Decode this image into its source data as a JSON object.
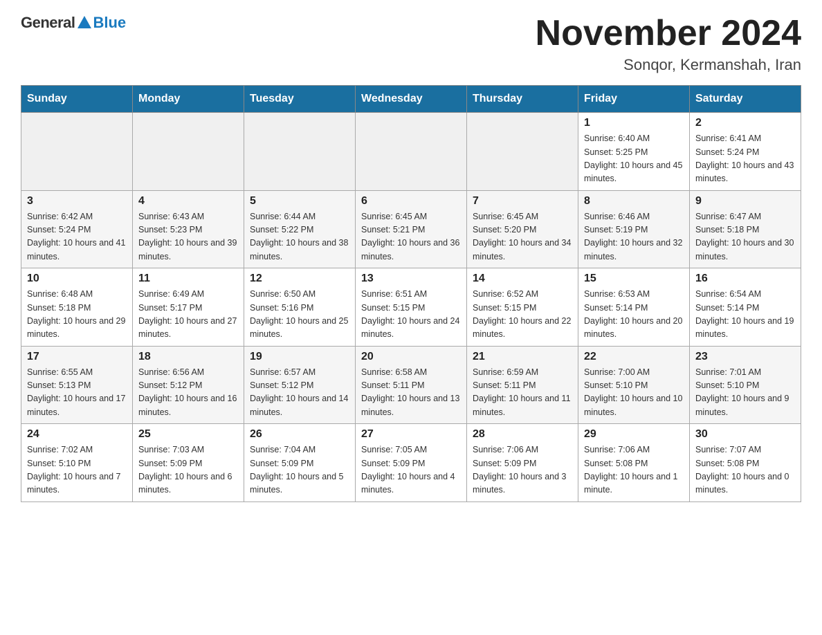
{
  "header": {
    "logo_general": "General",
    "logo_blue": "Blue",
    "month_title": "November 2024",
    "location": "Sonqor, Kermanshah, Iran"
  },
  "weekdays": [
    "Sunday",
    "Monday",
    "Tuesday",
    "Wednesday",
    "Thursday",
    "Friday",
    "Saturday"
  ],
  "weeks": [
    [
      {
        "day": "",
        "info": ""
      },
      {
        "day": "",
        "info": ""
      },
      {
        "day": "",
        "info": ""
      },
      {
        "day": "",
        "info": ""
      },
      {
        "day": "",
        "info": ""
      },
      {
        "day": "1",
        "info": "Sunrise: 6:40 AM\nSunset: 5:25 PM\nDaylight: 10 hours and 45 minutes."
      },
      {
        "day": "2",
        "info": "Sunrise: 6:41 AM\nSunset: 5:24 PM\nDaylight: 10 hours and 43 minutes."
      }
    ],
    [
      {
        "day": "3",
        "info": "Sunrise: 6:42 AM\nSunset: 5:24 PM\nDaylight: 10 hours and 41 minutes."
      },
      {
        "day": "4",
        "info": "Sunrise: 6:43 AM\nSunset: 5:23 PM\nDaylight: 10 hours and 39 minutes."
      },
      {
        "day": "5",
        "info": "Sunrise: 6:44 AM\nSunset: 5:22 PM\nDaylight: 10 hours and 38 minutes."
      },
      {
        "day": "6",
        "info": "Sunrise: 6:45 AM\nSunset: 5:21 PM\nDaylight: 10 hours and 36 minutes."
      },
      {
        "day": "7",
        "info": "Sunrise: 6:45 AM\nSunset: 5:20 PM\nDaylight: 10 hours and 34 minutes."
      },
      {
        "day": "8",
        "info": "Sunrise: 6:46 AM\nSunset: 5:19 PM\nDaylight: 10 hours and 32 minutes."
      },
      {
        "day": "9",
        "info": "Sunrise: 6:47 AM\nSunset: 5:18 PM\nDaylight: 10 hours and 30 minutes."
      }
    ],
    [
      {
        "day": "10",
        "info": "Sunrise: 6:48 AM\nSunset: 5:18 PM\nDaylight: 10 hours and 29 minutes."
      },
      {
        "day": "11",
        "info": "Sunrise: 6:49 AM\nSunset: 5:17 PM\nDaylight: 10 hours and 27 minutes."
      },
      {
        "day": "12",
        "info": "Sunrise: 6:50 AM\nSunset: 5:16 PM\nDaylight: 10 hours and 25 minutes."
      },
      {
        "day": "13",
        "info": "Sunrise: 6:51 AM\nSunset: 5:15 PM\nDaylight: 10 hours and 24 minutes."
      },
      {
        "day": "14",
        "info": "Sunrise: 6:52 AM\nSunset: 5:15 PM\nDaylight: 10 hours and 22 minutes."
      },
      {
        "day": "15",
        "info": "Sunrise: 6:53 AM\nSunset: 5:14 PM\nDaylight: 10 hours and 20 minutes."
      },
      {
        "day": "16",
        "info": "Sunrise: 6:54 AM\nSunset: 5:14 PM\nDaylight: 10 hours and 19 minutes."
      }
    ],
    [
      {
        "day": "17",
        "info": "Sunrise: 6:55 AM\nSunset: 5:13 PM\nDaylight: 10 hours and 17 minutes."
      },
      {
        "day": "18",
        "info": "Sunrise: 6:56 AM\nSunset: 5:12 PM\nDaylight: 10 hours and 16 minutes."
      },
      {
        "day": "19",
        "info": "Sunrise: 6:57 AM\nSunset: 5:12 PM\nDaylight: 10 hours and 14 minutes."
      },
      {
        "day": "20",
        "info": "Sunrise: 6:58 AM\nSunset: 5:11 PM\nDaylight: 10 hours and 13 minutes."
      },
      {
        "day": "21",
        "info": "Sunrise: 6:59 AM\nSunset: 5:11 PM\nDaylight: 10 hours and 11 minutes."
      },
      {
        "day": "22",
        "info": "Sunrise: 7:00 AM\nSunset: 5:10 PM\nDaylight: 10 hours and 10 minutes."
      },
      {
        "day": "23",
        "info": "Sunrise: 7:01 AM\nSunset: 5:10 PM\nDaylight: 10 hours and 9 minutes."
      }
    ],
    [
      {
        "day": "24",
        "info": "Sunrise: 7:02 AM\nSunset: 5:10 PM\nDaylight: 10 hours and 7 minutes."
      },
      {
        "day": "25",
        "info": "Sunrise: 7:03 AM\nSunset: 5:09 PM\nDaylight: 10 hours and 6 minutes."
      },
      {
        "day": "26",
        "info": "Sunrise: 7:04 AM\nSunset: 5:09 PM\nDaylight: 10 hours and 5 minutes."
      },
      {
        "day": "27",
        "info": "Sunrise: 7:05 AM\nSunset: 5:09 PM\nDaylight: 10 hours and 4 minutes."
      },
      {
        "day": "28",
        "info": "Sunrise: 7:06 AM\nSunset: 5:09 PM\nDaylight: 10 hours and 3 minutes."
      },
      {
        "day": "29",
        "info": "Sunrise: 7:06 AM\nSunset: 5:08 PM\nDaylight: 10 hours and 1 minute."
      },
      {
        "day": "30",
        "info": "Sunrise: 7:07 AM\nSunset: 5:08 PM\nDaylight: 10 hours and 0 minutes."
      }
    ]
  ]
}
